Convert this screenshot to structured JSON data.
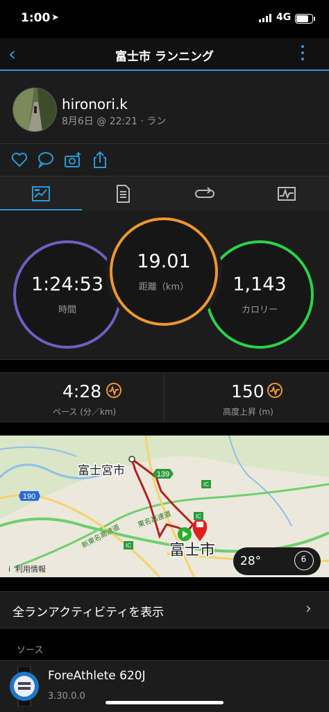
{
  "status": {
    "time": "1:00",
    "network": "4G"
  },
  "nav": {
    "title": "富士市 ランニング"
  },
  "profile": {
    "username": "hironori.k",
    "meta": "8月6日 @ 22:21 · ラン"
  },
  "tabs": [
    "overview-icon",
    "details-icon",
    "laps-icon",
    "charts-icon"
  ],
  "stats": {
    "time": {
      "value": "1:24:53",
      "label": "時間",
      "color": "#6f5fc0"
    },
    "distance": {
      "value": "19.01",
      "label": "距離（km）",
      "color": "#f0962e"
    },
    "calories": {
      "value": "1,143",
      "label": "カロリー",
      "color": "#2ad24a"
    }
  },
  "pace": {
    "value": "4:28",
    "label": "ペース (分／km)"
  },
  "ascent": {
    "value": "150",
    "label": "高度上昇 (m)"
  },
  "map": {
    "labels": {
      "city": "富士宮市",
      "city2": "富士市",
      "route139": "139",
      "route190": "190",
      "ic1": "IC",
      "ic2": "IC",
      "ic3": "IC",
      "expressway": "東名高速道",
      "expressway2": "新東名高速道",
      "legal": "利用情報"
    },
    "weather": {
      "temp": "28°",
      "wind": "6"
    }
  },
  "all_runs": "全ランアクティビティを表示",
  "source": {
    "header": "ソース",
    "device": "ForeAthlete 620J",
    "version": "3.30.0.0"
  },
  "colors": {
    "accent": "#2a9ad6",
    "garmin_orange": "#f0962e"
  }
}
